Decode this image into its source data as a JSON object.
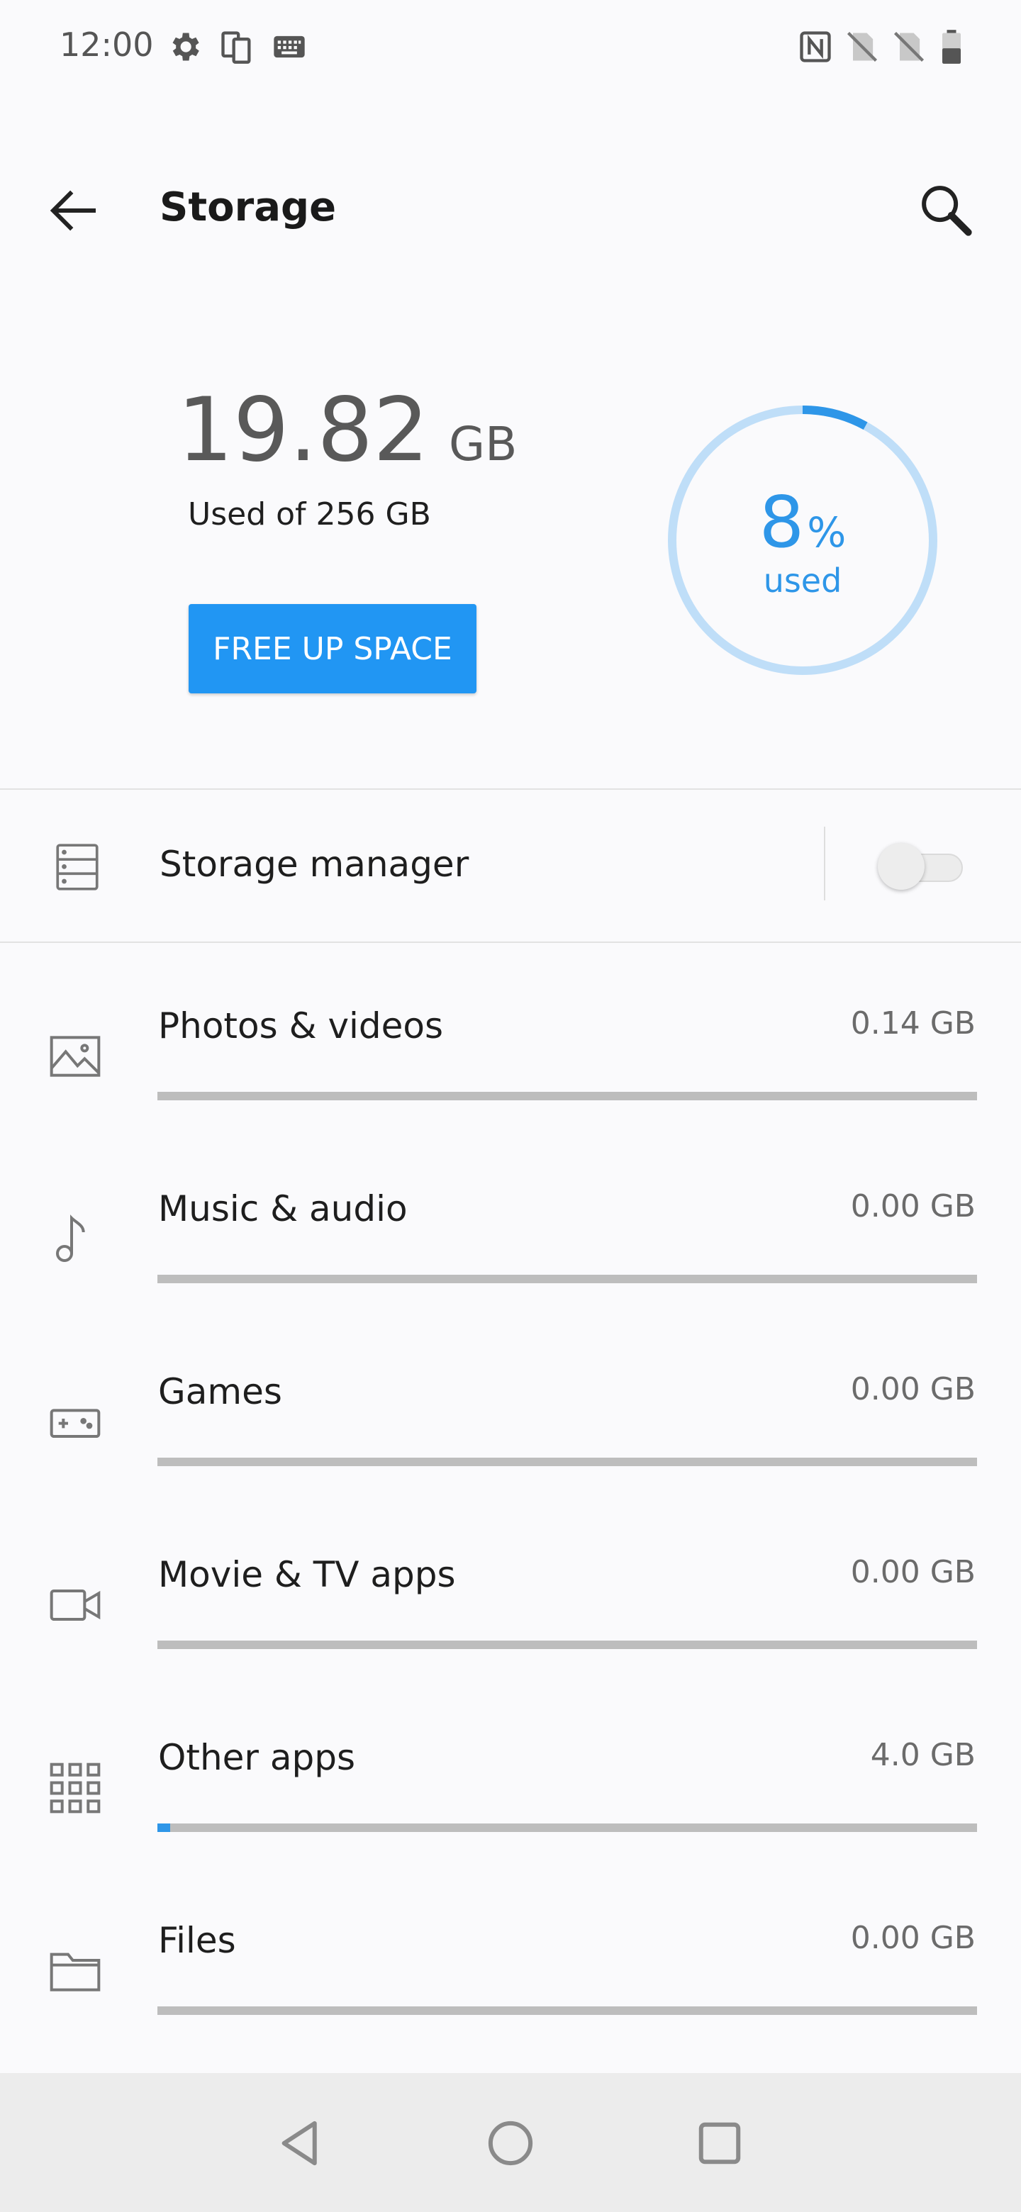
{
  "status_bar": {
    "time": "12:00",
    "left_icons": [
      "gear-icon",
      "screen-rotate-icon",
      "keyboard-icon"
    ],
    "right_icons": [
      "nfc-icon",
      "no-sim-icon",
      "no-sim-icon",
      "battery-icon"
    ]
  },
  "app_bar": {
    "title": "Storage",
    "back_icon": "arrow-left-icon",
    "search_icon": "search-icon"
  },
  "summary": {
    "used_value": "19.82",
    "used_unit": "GB",
    "used_of": "Used of 256 GB",
    "free_button_label": "FREE UP SPACE",
    "percent_value": "8",
    "percent_symbol": "%",
    "percent_label": "used",
    "percent_fraction": 0.08
  },
  "storage_manager": {
    "label": "Storage manager",
    "enabled": false
  },
  "categories": [
    {
      "label": "Photos & videos",
      "size": "0.14 GB",
      "icon": "image-icon",
      "fraction": 0.0
    },
    {
      "label": "Music & audio",
      "size": "0.00 GB",
      "icon": "music-note-icon",
      "fraction": 0.0
    },
    {
      "label": "Games",
      "size": "0.00 GB",
      "icon": "gamepad-icon",
      "fraction": 0.0
    },
    {
      "label": "Movie & TV apps",
      "size": "0.00 GB",
      "icon": "video-camera-icon",
      "fraction": 0.0
    },
    {
      "label": "Other apps",
      "size": "4.0 GB",
      "icon": "apps-grid-icon",
      "fraction": 0.016
    },
    {
      "label": "Files",
      "size": "0.00 GB",
      "icon": "folder-icon",
      "fraction": 0.0
    }
  ],
  "colors": {
    "accent": "#2196f3",
    "ring_track": "#bfdef8",
    "ring_fill": "#2e96e8",
    "bar_track": "#bdbdbd"
  },
  "nav_bar": {
    "buttons": [
      "back-triangle-icon",
      "home-circle-icon",
      "recents-square-icon"
    ]
  }
}
